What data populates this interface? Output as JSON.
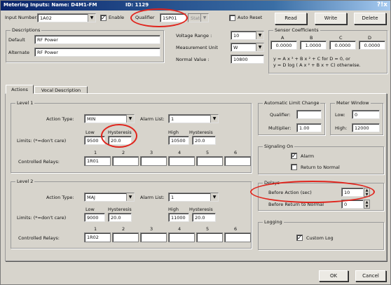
{
  "window": {
    "title": "Metering Inputs: Name: D4M1-FM",
    "id_text": "ID: 1129",
    "help": "?!x"
  },
  "top": {
    "input_number_label": "Input Number:",
    "input_number_value": "1A02",
    "enable_label": "Enable",
    "enable_checked": true,
    "qualifier_label": "Qualifier",
    "qualifier_value": "1SP01",
    "state_value": "State",
    "auto_reset_label": "Auto Reset",
    "read_label": "Read",
    "write_label": "Write",
    "delete_label": "Delete"
  },
  "descriptions": {
    "title": "Descriptions",
    "default_label": "Default",
    "default_value": "RF Power",
    "alternate_label": "Alternate",
    "alternate_value": "RF Power"
  },
  "measure": {
    "voltage_range_label": "Voltage Range :",
    "voltage_range_value": "10",
    "measurement_unit_label": "Measurement Unit",
    "measurement_unit_value": "W",
    "normal_value_label": "Normal Value :",
    "normal_value": "10800"
  },
  "sensor": {
    "title": "Sensor Coefficients",
    "headers": [
      "A",
      "B",
      "C",
      "D"
    ],
    "values": [
      "0.0000",
      "1.0000",
      "0.0000",
      "0.0000"
    ],
    "formula1": "y = A x ³ + B x ² + C for D = 0, or",
    "formula2": "y = D log ( A x ² + B x + C) otherwise."
  },
  "tabs": {
    "actions": "Actions",
    "vocal": "Vocal Description"
  },
  "level1": {
    "title": "Level 1",
    "action_type_label": "Action Type:",
    "action_type_value": "MIN",
    "alarm_list_label": "Alarm List:",
    "alarm_list_value": "1",
    "limits_label": "Limits: (*=don't care)",
    "low_label": "Low",
    "low_value": "9500",
    "hyst1_label": "Hysteresis",
    "hyst1_value": "20.0",
    "high_label": "High",
    "high_value": "10500",
    "hyst2_label": "Hysteresis",
    "hyst2_value": "20.0",
    "relay_numbers": [
      "1",
      "2",
      "3",
      "4",
      "5",
      "6"
    ],
    "controlled_relays_label": "Controlled Relays:",
    "relay_values": [
      "1R01",
      "",
      "",
      "",
      "",
      ""
    ]
  },
  "level2": {
    "title": "Level 2",
    "action_type_label": "Action Type:",
    "action_type_value": "MAJ",
    "alarm_list_label": "Alarm List:",
    "alarm_list_value": "1",
    "limits_label": "Limits: (*=don't care)",
    "low_label": "Low",
    "low_value": "9000",
    "hyst1_label": "Hysteresis",
    "hyst1_value": "20.0",
    "high_label": "High",
    "high_value": "11000",
    "hyst2_label": "Hysteresis",
    "hyst2_value": "20.0",
    "relay_numbers": [
      "1",
      "2",
      "3",
      "4",
      "5",
      "6"
    ],
    "controlled_relays_label": "Controlled Relays:",
    "relay_values": [
      "1R02",
      "",
      "",
      "",
      "",
      ""
    ]
  },
  "auto_limit": {
    "title": "Automatic Limit Change",
    "qualifier_label": "Qualifier:",
    "qualifier_value": "",
    "multiplier_label": "Multiplier:",
    "multiplier_value": "1.00"
  },
  "meter_window": {
    "title": "Meter Window",
    "low_label": "Low:",
    "low_value": "0",
    "high_label": "High:",
    "high_value": "12000"
  },
  "signaling": {
    "title": "Signaling On",
    "alarm_label": "Alarm",
    "alarm_checked": true,
    "return_label": "Return to Normal",
    "return_checked": false
  },
  "delays": {
    "title": "Delays",
    "before_action_label": "Before Action (sec)",
    "before_action_value": "10",
    "before_return_label": "Before Return to Normal",
    "before_return_value": "0"
  },
  "logging": {
    "title": "Logging",
    "custom_log_label": "Custom Log",
    "custom_log_checked": true
  },
  "footer": {
    "ok_label": "OK",
    "cancel_label": "Cancel"
  }
}
